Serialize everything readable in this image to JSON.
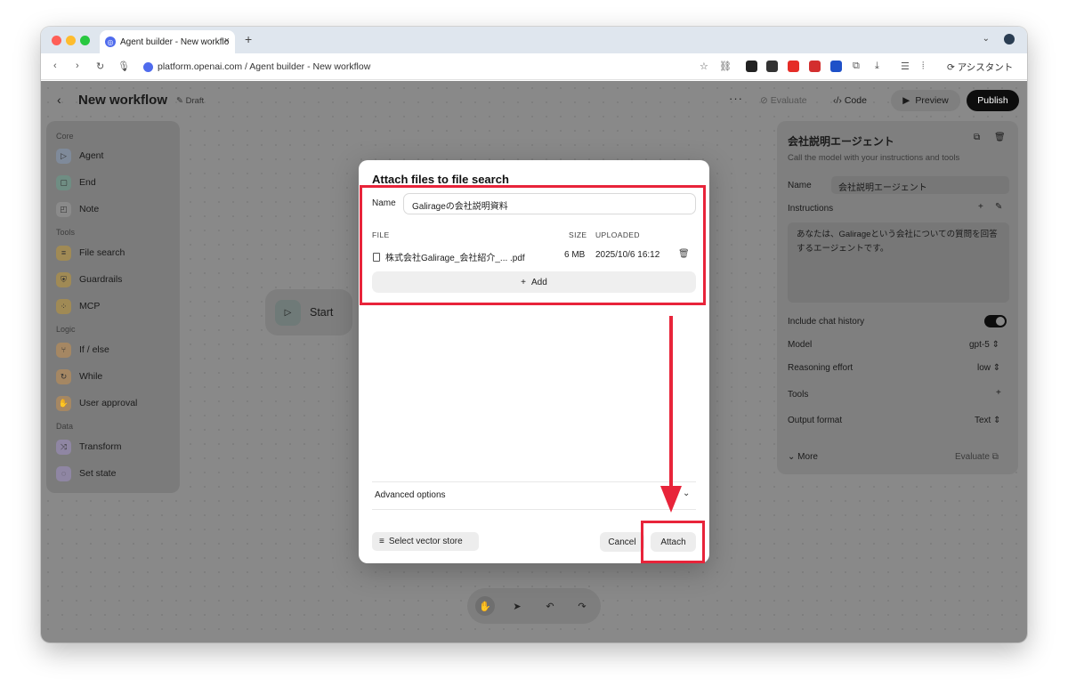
{
  "browser": {
    "tab_title": "Agent builder - New workflo",
    "tab_close": "×",
    "new_tab": "+",
    "url": "platform.openai.com / Agent builder - New workflow",
    "assistant_label": "アシスタント"
  },
  "header": {
    "back": "‹",
    "title": "New workflow",
    "draft": "Draft",
    "more": "···",
    "evaluate": "Evaluate",
    "code": "Code",
    "preview": "Preview",
    "publish": "Publish"
  },
  "sidebar": {
    "sections": [
      {
        "label": "Core",
        "items": [
          {
            "label": "Agent",
            "icon": "agent-icon",
            "color": "#7f8a9a"
          },
          {
            "label": "End",
            "icon": "end-icon",
            "color": "#6f8d83"
          },
          {
            "label": "Note",
            "icon": "note-icon",
            "color": "#8a8a8a"
          }
        ]
      },
      {
        "label": "Tools",
        "items": [
          {
            "label": "File search",
            "icon": "database-icon",
            "color": "#a08a55"
          },
          {
            "label": "Guardrails",
            "icon": "shield-icon",
            "color": "#a08a55"
          },
          {
            "label": "MCP",
            "icon": "mcp-icon",
            "color": "#a08a55"
          }
        ]
      },
      {
        "label": "Logic",
        "items": [
          {
            "label": "If / else",
            "icon": "branch-icon",
            "color": "#a58763"
          },
          {
            "label": "While",
            "icon": "loop-icon",
            "color": "#a58763"
          },
          {
            "label": "User approval",
            "icon": "approval-icon",
            "color": "#a58763"
          }
        ]
      },
      {
        "label": "Data",
        "items": [
          {
            "label": "Transform",
            "icon": "shuffle-icon",
            "color": "#8f86a3"
          },
          {
            "label": "Set state",
            "icon": "state-icon",
            "color": "#8f86a3"
          }
        ]
      }
    ]
  },
  "canvas": {
    "start_label": "Start"
  },
  "inspector": {
    "title": "会社説明エージェント",
    "subtitle": "Call the model with your instructions and tools",
    "name_label": "Name",
    "name_value": "会社説明エージェント",
    "instructions_label": "Instructions",
    "instructions_text": "あなたは、Galirageという会社についての質問を回答するエージェントです。",
    "chat_history_label": "Include chat history",
    "chat_history_on": true,
    "model_label": "Model",
    "model_value": "gpt-5",
    "reasoning_label": "Reasoning effort",
    "reasoning_value": "low",
    "tools_label": "Tools",
    "output_label": "Output format",
    "output_value": "Text",
    "more_label": "More",
    "evaluate_label": "Evaluate"
  },
  "modal": {
    "title": "Attach files to file search",
    "name_label": "Name",
    "name_value": "Galirageの会社説明資料",
    "columns": {
      "file": "FILE",
      "size": "SIZE",
      "uploaded": "UPLOADED"
    },
    "files": [
      {
        "name": "株式会社Galirage_会社紹介_... .pdf",
        "size": "6 MB",
        "uploaded": "2025/10/6 16:12"
      }
    ],
    "add_label": "Add",
    "advanced_label": "Advanced options",
    "select_vector_label": "Select vector store",
    "cancel_label": "Cancel",
    "attach_label": "Attach"
  },
  "annotation_color": "#e8243a"
}
